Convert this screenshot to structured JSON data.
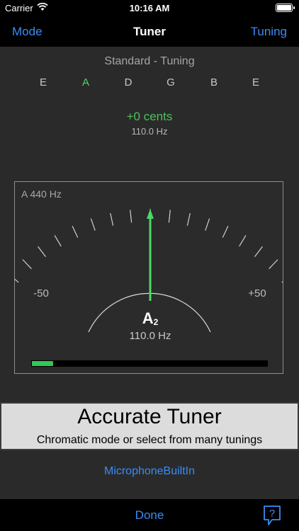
{
  "status_bar": {
    "carrier": "Carrier",
    "time": "10:16 AM"
  },
  "nav": {
    "left": "Mode",
    "title": "Tuner",
    "right": "Tuning"
  },
  "tuning": {
    "name": "Standard - Tuning",
    "strings": [
      "E",
      "A",
      "D",
      "G",
      "B",
      "E"
    ],
    "active_index": 1
  },
  "readout": {
    "cents": "+0 cents",
    "frequency": "110.0 Hz"
  },
  "meter": {
    "reference": "A 440 Hz",
    "min_label": "-50",
    "max_label": "+50",
    "note": "A",
    "octave": "2",
    "frequency": "110.0 Hz",
    "needle_cents": 0,
    "level": 0.09
  },
  "banner": {
    "title": "Accurate Tuner",
    "subtitle": "Chromatic mode or select from many tunings"
  },
  "input_device": "MicrophoneBuiltIn",
  "bottom": {
    "done": "Done",
    "help": "?"
  },
  "colors": {
    "accent": "#3b8bf4",
    "in_tune": "#4cd964",
    "level": "#34c759"
  }
}
